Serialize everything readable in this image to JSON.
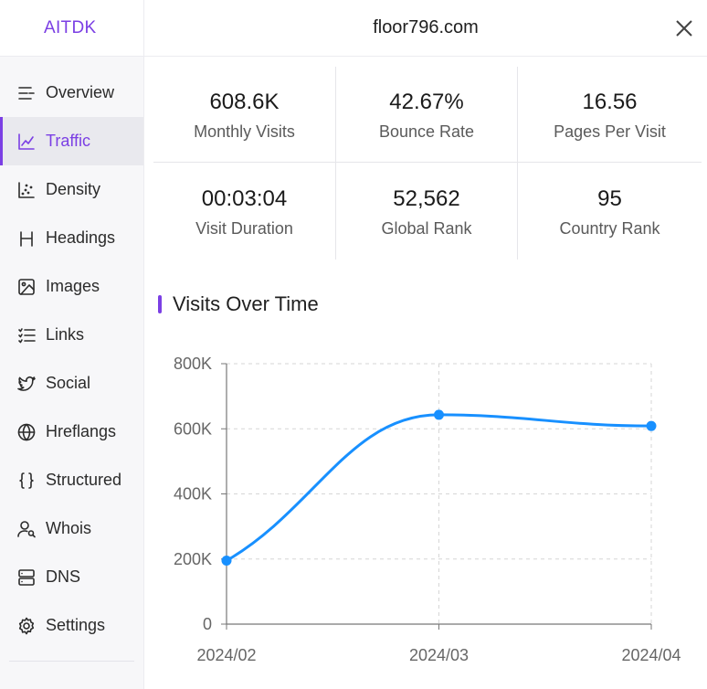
{
  "brand": "AITDK",
  "header": {
    "domain": "floor796.com"
  },
  "sidebar": {
    "items": [
      {
        "label": "Overview",
        "icon": "overview-icon"
      },
      {
        "label": "Traffic",
        "icon": "traffic-chart-icon",
        "active": true
      },
      {
        "label": "Density",
        "icon": "density-icon"
      },
      {
        "label": "Headings",
        "icon": "heading-icon"
      },
      {
        "label": "Images",
        "icon": "image-icon"
      },
      {
        "label": "Links",
        "icon": "links-icon"
      },
      {
        "label": "Social",
        "icon": "twitter-icon"
      },
      {
        "label": "Hreflangs",
        "icon": "globe-icon"
      },
      {
        "label": "Structured",
        "icon": "braces-icon"
      },
      {
        "label": "Whois",
        "icon": "user-search-icon"
      },
      {
        "label": "DNS",
        "icon": "server-icon"
      },
      {
        "label": "Settings",
        "icon": "gear-icon"
      }
    ]
  },
  "stats": [
    {
      "value": "608.6K",
      "label": "Monthly Visits"
    },
    {
      "value": "42.67%",
      "label": "Bounce Rate"
    },
    {
      "value": "16.56",
      "label": "Pages Per Visit"
    },
    {
      "value": "00:03:04",
      "label": "Visit Duration"
    },
    {
      "value": "52,562",
      "label": "Global Rank"
    },
    {
      "value": "95",
      "label": "Country Rank"
    }
  ],
  "section": {
    "title": "Visits Over Time"
  },
  "colors": {
    "accent": "#7b3fe4",
    "line": "#1890ff"
  },
  "chart_data": {
    "type": "line",
    "categories": [
      "2024/02",
      "2024/03",
      "2024/04"
    ],
    "series": [
      {
        "values": [
          195000,
          643000,
          608600
        ]
      }
    ],
    "y_ticks": [
      "0",
      "200K",
      "400K",
      "600K",
      "800K"
    ],
    "y_tick_values": [
      0,
      200000,
      400000,
      600000,
      800000
    ],
    "ylim": [
      0,
      800000
    ],
    "grid": true,
    "smooth": true
  }
}
